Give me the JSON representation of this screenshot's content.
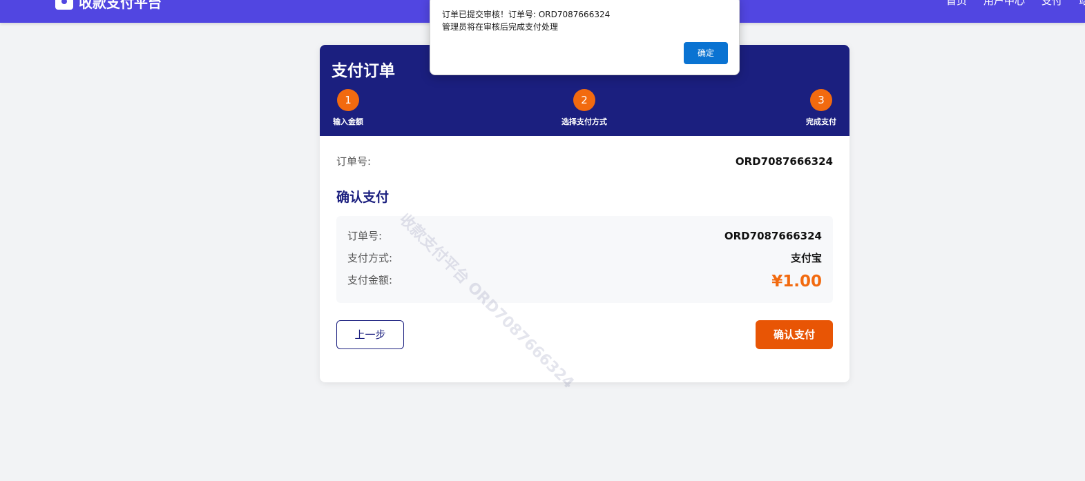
{
  "topbar": {
    "brand": "收款支付平台",
    "nav": [
      "首页",
      "用户中心",
      "支付",
      "站"
    ]
  },
  "card": {
    "title": "支付订单",
    "steps": [
      {
        "number": "1",
        "label": "输入金额"
      },
      {
        "number": "2",
        "label": "选择支付方式"
      },
      {
        "number": "3",
        "label": "完成支付"
      }
    ],
    "order_label": "订单号:",
    "order_value": "ORD7087666324",
    "section_title": "确认支付",
    "summary": {
      "order_label": "订单号:",
      "order_value": "ORD7087666324",
      "method_label": "支付方式:",
      "method_value": "支付宝",
      "amount_label": "支付金额:",
      "amount_value": "¥1.00"
    },
    "prev_button": "上一步",
    "confirm_button": "确认支付",
    "watermark": "收款支付平台 ORD7087666324"
  },
  "dialog": {
    "line1": "订单已提交审核！订单号: ORD7087666324",
    "line2": "管理员将在审核后完成支付处理",
    "ok_button": "确定"
  },
  "colors": {
    "topbar": "#5146e1",
    "header": "#1b1f7f",
    "accent": "#f26a0f",
    "confirm": "#e85505",
    "dialog_button": "#0a73d2"
  }
}
